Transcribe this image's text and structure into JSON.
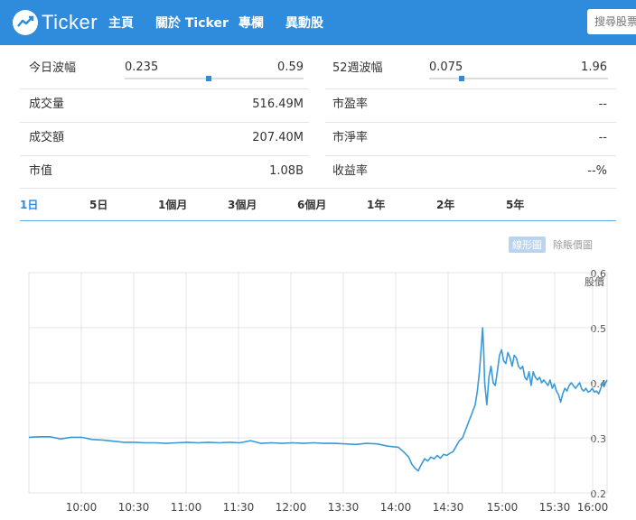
{
  "header": {
    "brand": "Ticker",
    "nav": [
      "主頁",
      "關於 Ticker",
      "專欄",
      "異動股"
    ],
    "search_placeholder": "搜尋股票"
  },
  "stats": {
    "day_range": {
      "label": "今日波幅",
      "low": "0.235",
      "high": "0.59",
      "position": 0.47
    },
    "week52_range": {
      "label": "52週波幅",
      "low": "0.075",
      "high": "1.96",
      "position": 0.18
    },
    "rows_left": [
      {
        "label": "成交量",
        "value": "516.49M"
      },
      {
        "label": "成交額",
        "value": "207.40M"
      },
      {
        "label": "市值",
        "value": "1.08B"
      }
    ],
    "rows_right": [
      {
        "label": "市盈率",
        "value": "--"
      },
      {
        "label": "市淨率",
        "value": "--"
      },
      {
        "label": "收益率",
        "value": "--%"
      }
    ]
  },
  "periods": [
    "1日",
    "5日",
    "1個月",
    "3個月",
    "6個月",
    "1年",
    "2年",
    "5年"
  ],
  "active_period": "1日",
  "chart_toggle": {
    "active": "線形圖",
    "inactive": "除賬價圖"
  },
  "colors": {
    "header": "#2f8bdc",
    "line": "#3a9ad9",
    "tab_active": "#2f8bdc"
  },
  "chart_data": {
    "type": "line",
    "ylabel": "股價",
    "ylim": [
      0.2,
      0.6
    ],
    "yticks": [
      0.2,
      0.3,
      0.4,
      0.5,
      0.6
    ],
    "xticks": [
      "10:00",
      "10:30",
      "11:00",
      "11:30",
      "12:00",
      "13:30",
      "14:00",
      "14:30",
      "15:00",
      "15:30",
      "16:00"
    ],
    "grid": true,
    "series": [
      {
        "values": [
          [
            0,
            0.301
          ],
          [
            10,
            0.302
          ],
          [
            20,
            0.302
          ],
          [
            30,
            0.298
          ],
          [
            40,
            0.301
          ],
          [
            50,
            0.301
          ],
          [
            60,
            0.297
          ],
          [
            70,
            0.296
          ],
          [
            80,
            0.294
          ],
          [
            90,
            0.292
          ],
          [
            100,
            0.292
          ],
          [
            110,
            0.291
          ],
          [
            120,
            0.291
          ],
          [
            130,
            0.29
          ],
          [
            140,
            0.291
          ],
          [
            150,
            0.292
          ],
          [
            160,
            0.291
          ],
          [
            170,
            0.292
          ],
          [
            180,
            0.291
          ],
          [
            190,
            0.292
          ],
          [
            200,
            0.291
          ],
          [
            210,
            0.295
          ],
          [
            220,
            0.29
          ],
          [
            230,
            0.291
          ],
          [
            240,
            0.29
          ],
          [
            250,
            0.291
          ],
          [
            260,
            0.29
          ],
          [
            270,
            0.291
          ],
          [
            280,
            0.29
          ],
          [
            290,
            0.29
          ],
          [
            300,
            0.289
          ],
          [
            310,
            0.288
          ],
          [
            320,
            0.29
          ],
          [
            330,
            0.289
          ],
          [
            340,
            0.285
          ],
          [
            350,
            0.283
          ],
          [
            355,
            0.275
          ],
          [
            360,
            0.265
          ],
          [
            363,
            0.252
          ],
          [
            366,
            0.245
          ],
          [
            369,
            0.24
          ],
          [
            372,
            0.252
          ],
          [
            375,
            0.262
          ],
          [
            378,
            0.258
          ],
          [
            381,
            0.265
          ],
          [
            384,
            0.262
          ],
          [
            387,
            0.268
          ],
          [
            390,
            0.263
          ],
          [
            393,
            0.27
          ],
          [
            396,
            0.268
          ],
          [
            399,
            0.272
          ],
          [
            402,
            0.275
          ],
          [
            405,
            0.285
          ],
          [
            408,
            0.295
          ],
          [
            411,
            0.3
          ],
          [
            414,
            0.315
          ],
          [
            417,
            0.33
          ],
          [
            420,
            0.345
          ],
          [
            423,
            0.36
          ],
          [
            425,
            0.385
          ],
          [
            427,
            0.42
          ],
          [
            429,
            0.47
          ],
          [
            430,
            0.5
          ],
          [
            431,
            0.46
          ],
          [
            432,
            0.4
          ],
          [
            434,
            0.36
          ],
          [
            436,
            0.41
          ],
          [
            438,
            0.43
          ],
          [
            440,
            0.4
          ],
          [
            442,
            0.395
          ],
          [
            444,
            0.42
          ],
          [
            446,
            0.45
          ],
          [
            448,
            0.46
          ],
          [
            450,
            0.44
          ],
          [
            452,
            0.435
          ],
          [
            454,
            0.455
          ],
          [
            456,
            0.445
          ],
          [
            458,
            0.43
          ],
          [
            460,
            0.45
          ],
          [
            462,
            0.445
          ],
          [
            464,
            0.43
          ],
          [
            466,
            0.425
          ],
          [
            468,
            0.43
          ],
          [
            470,
            0.41
          ],
          [
            472,
            0.405
          ],
          [
            474,
            0.42
          ],
          [
            476,
            0.395
          ],
          [
            478,
            0.42
          ],
          [
            480,
            0.41
          ],
          [
            482,
            0.405
          ],
          [
            484,
            0.41
          ],
          [
            486,
            0.4
          ],
          [
            488,
            0.405
          ],
          [
            490,
            0.4
          ],
          [
            492,
            0.395
          ],
          [
            494,
            0.405
          ],
          [
            496,
            0.39
          ],
          [
            498,
            0.398
          ],
          [
            500,
            0.385
          ],
          [
            502,
            0.378
          ],
          [
            504,
            0.365
          ],
          [
            506,
            0.38
          ],
          [
            508,
            0.39
          ],
          [
            510,
            0.385
          ],
          [
            512,
            0.395
          ],
          [
            514,
            0.4
          ],
          [
            516,
            0.395
          ],
          [
            518,
            0.39
          ],
          [
            520,
            0.395
          ],
          [
            522,
            0.4
          ],
          [
            524,
            0.388
          ],
          [
            526,
            0.385
          ],
          [
            528,
            0.39
          ],
          [
            530,
            0.383
          ],
          [
            532,
            0.385
          ],
          [
            534,
            0.39
          ],
          [
            536,
            0.383
          ],
          [
            538,
            0.385
          ],
          [
            540,
            0.38
          ],
          [
            542,
            0.39
          ],
          [
            544,
            0.4
          ],
          [
            546,
            0.398
          ],
          [
            548,
            0.405
          ]
        ]
      }
    ]
  }
}
